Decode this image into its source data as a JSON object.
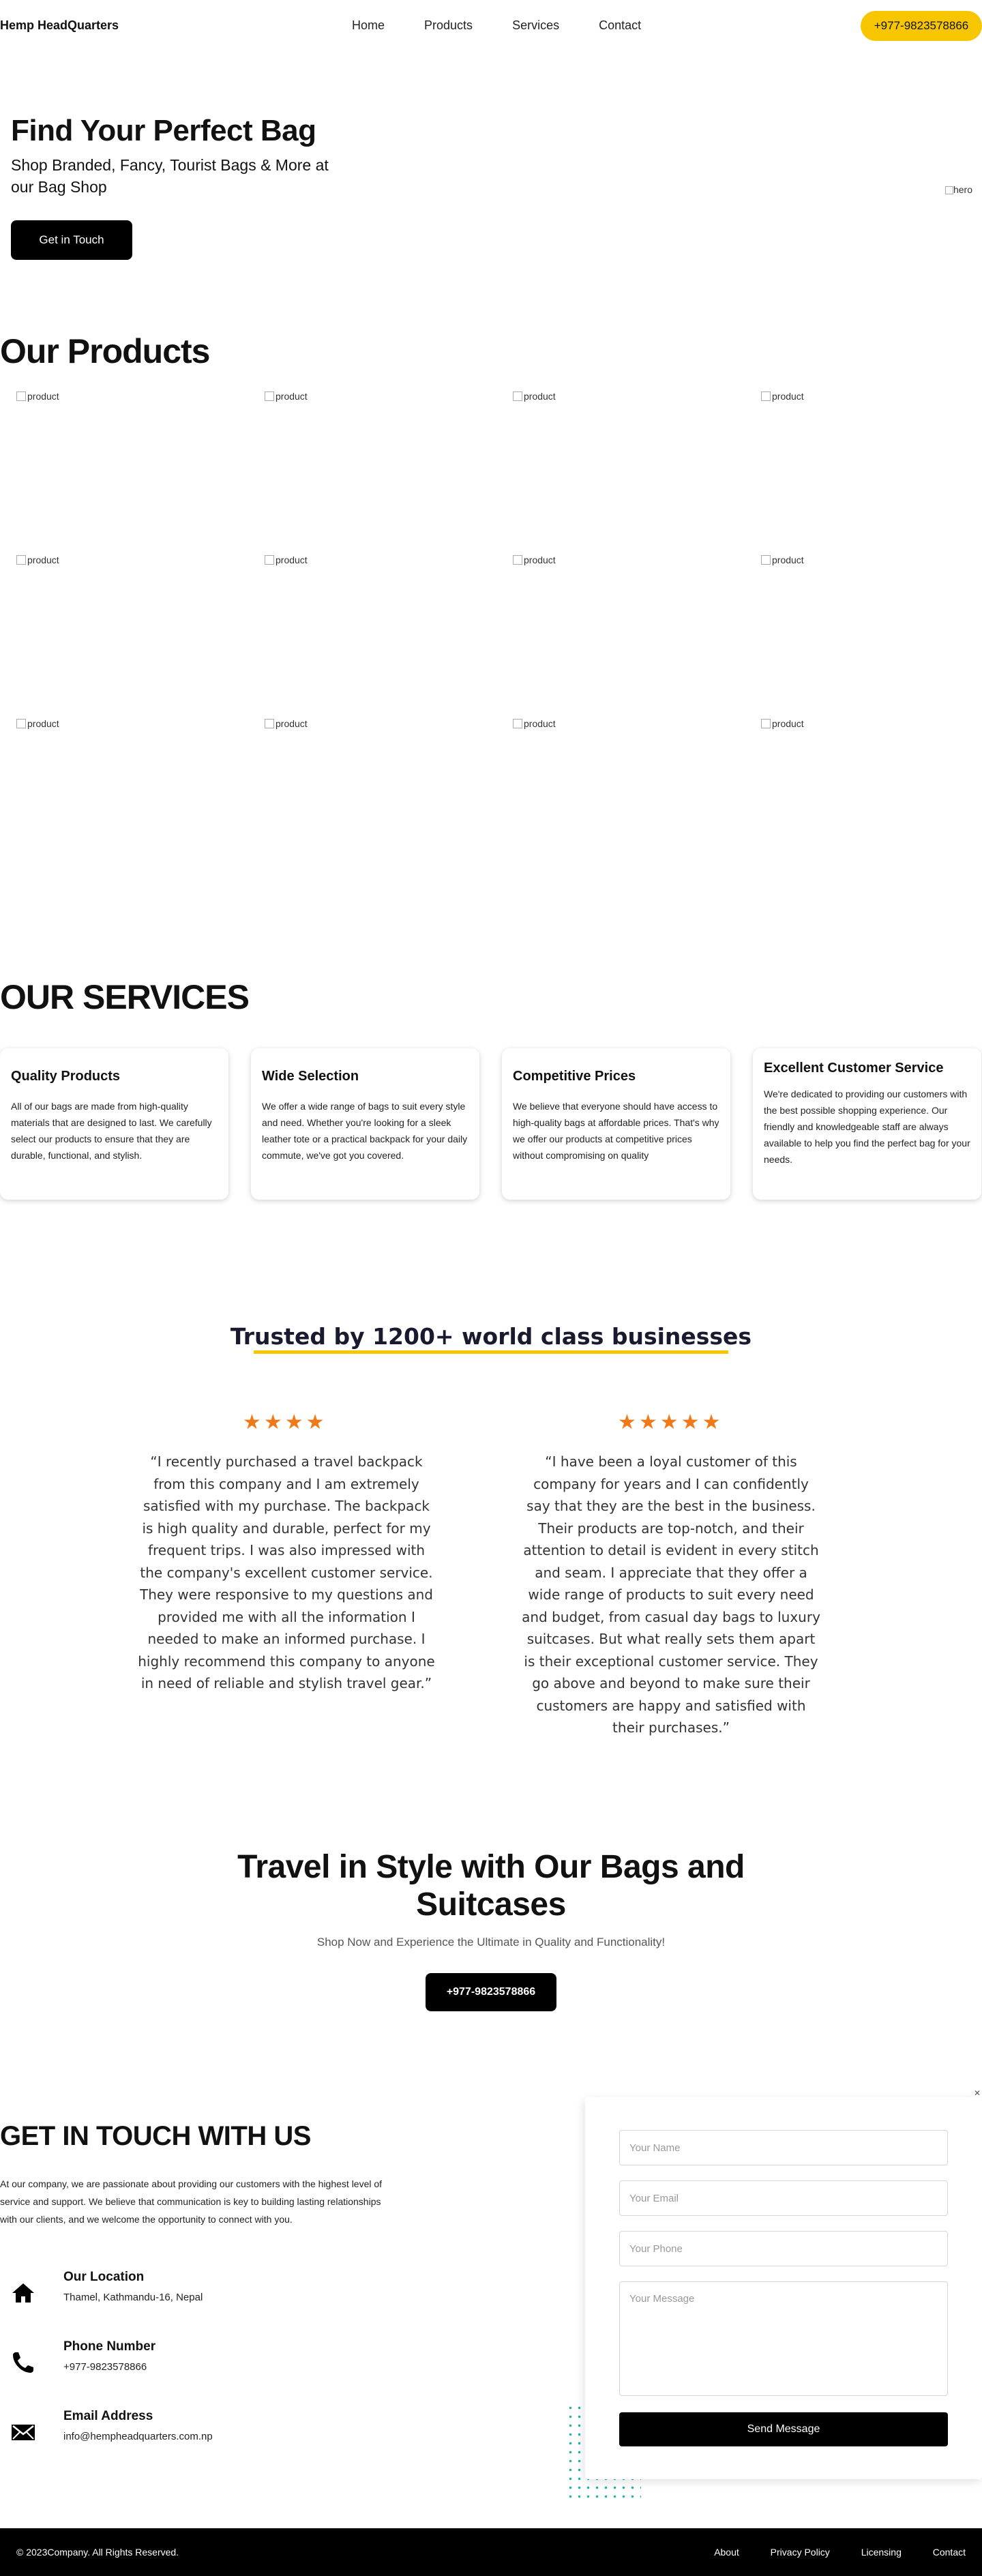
{
  "header": {
    "brand": "Hemp HeadQuarters",
    "nav": [
      "Home",
      "Products",
      "Services",
      "Contact"
    ],
    "phone": "+977-9823578866"
  },
  "hero": {
    "title": "Find Your Perfect Bag",
    "subtitle": "Shop Branded, Fancy, Tourist Bags & More at our Bag Shop",
    "cta": "Get in Touch",
    "image_alt": "hero"
  },
  "products": {
    "title": "Our Products",
    "items": [
      "product",
      "product",
      "product",
      "product",
      "product",
      "product",
      "product",
      "product",
      "product",
      "product",
      "product",
      "product"
    ]
  },
  "services": {
    "title": "OUR SERVICES",
    "cards": [
      {
        "title": "Quality Products",
        "text": "All of our bags are made from high-quality materials that are designed to last. We carefully select our products to ensure that they are durable, functional, and stylish."
      },
      {
        "title": "Wide Selection",
        "text": "We offer a wide range of bags to suit every style and need. Whether you're looking for a sleek leather tote or a practical backpack for your daily commute, we've got you covered."
      },
      {
        "title": "Competitive Prices",
        "text": "We believe that everyone should have access to high-quality bags at affordable prices. That's why we offer our products at competitive prices without compromising on quality"
      },
      {
        "title": "Excellent Customer Service",
        "text": "We're dedicated to providing our customers with the best possible shopping experience. Our friendly and knowledgeable staff are always available to help you find the perfect bag for your needs."
      }
    ]
  },
  "testimonials": {
    "title": "Trusted by 1200+ world class businesses",
    "items": [
      {
        "stars": "★★★★",
        "rating": 4,
        "quote": "“I recently purchased a travel backpack from this company and I am extremely satisfied with my purchase. The backpack is high quality and durable, perfect for my frequent trips. I was also impressed with the company's excellent customer service. They were responsive to my questions and provided me with all the information I needed to make an informed purchase. I highly recommend this company to anyone in need of reliable and stylish travel gear.”"
      },
      {
        "stars": "★★★★★",
        "rating": 5,
        "quote": "“I have been a loyal customer of this company for years and I can confidently say that they are the best in the business. Their products are top-notch, and their attention to detail is evident in every stitch and seam. I appreciate that they offer a wide range of products to suit every need and budget, from casual day bags to luxury suitcases. But what really sets them apart is their exceptional customer service. They go above and beyond to make sure their customers are happy and satisfied with their purchases.”"
      }
    ]
  },
  "cta": {
    "title": "Travel in Style with Our Bags and Suitcases",
    "subtitle": "Shop Now and Experience the Ultimate in Quality and Functionality!",
    "button": "+977-9823578866"
  },
  "contact": {
    "title": "GET IN TOUCH WITH US",
    "text": "At our company, we are passionate about providing our customers with the highest level of service and support. We believe that communication is key to building lasting relationships with our clients, and we welcome the opportunity to connect with you.",
    "items": [
      {
        "title": "Our Location",
        "value": "Thamel, Kathmandu-16, Nepal",
        "icon": "home-icon"
      },
      {
        "title": "Phone Number",
        "value": "+977-9823578866",
        "icon": "phone-icon"
      },
      {
        "title": "Email Address",
        "value": "info@hempheadquarters.com.np",
        "icon": "mail-icon"
      }
    ],
    "form": {
      "name_placeholder": "Your Name",
      "email_placeholder": "Your Email",
      "phone_placeholder": "Your Phone",
      "message_placeholder": "Your Message",
      "submit": "Send Message"
    }
  },
  "footer": {
    "copyright": "© 2023Company. All Rights Reserved.",
    "links": [
      "About",
      "Privacy Policy",
      "Licensing",
      "Contact"
    ]
  },
  "colors": {
    "accent": "#f7c600",
    "star": "#f07a1a",
    "dots": "#27b0a5"
  }
}
